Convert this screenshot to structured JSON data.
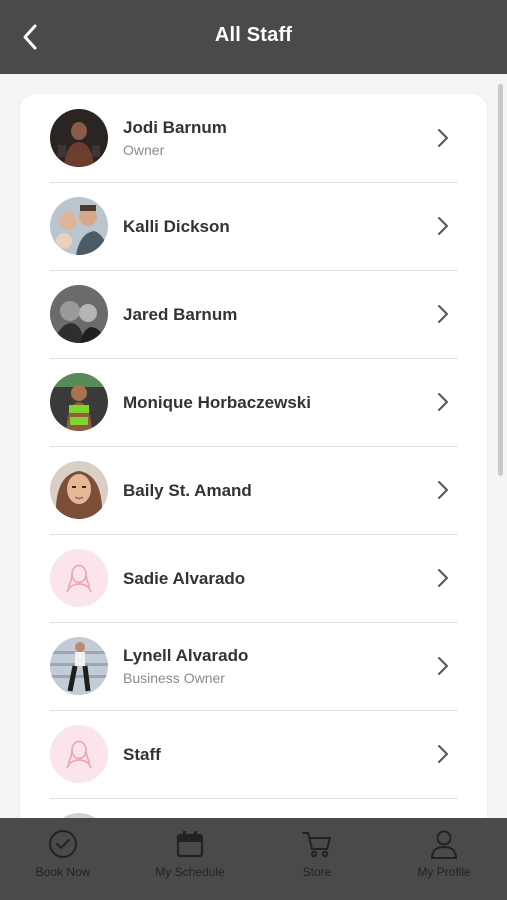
{
  "header": {
    "title": "All Staff"
  },
  "staff": [
    {
      "name": "Jodi Barnum",
      "role": "Owner"
    },
    {
      "name": "Kalli Dickson",
      "role": ""
    },
    {
      "name": "Jared Barnum",
      "role": ""
    },
    {
      "name": "Monique Horbaczewski",
      "role": ""
    },
    {
      "name": "Baily St. Amand",
      "role": ""
    },
    {
      "name": "Sadie Alvarado",
      "role": ""
    },
    {
      "name": "Lynell Alvarado",
      "role": "Business Owner"
    },
    {
      "name": "Staff",
      "role": ""
    }
  ],
  "tabbar": {
    "book_now": "Book Now",
    "my_schedule": "My Schedule",
    "store": "Store",
    "my_profile": "My Profile"
  },
  "colors": {
    "header_bg": "#4a4a4a",
    "placeholder_avatar_bg": "#fbe4ea",
    "placeholder_avatar_icon": "#e8a3b6"
  }
}
